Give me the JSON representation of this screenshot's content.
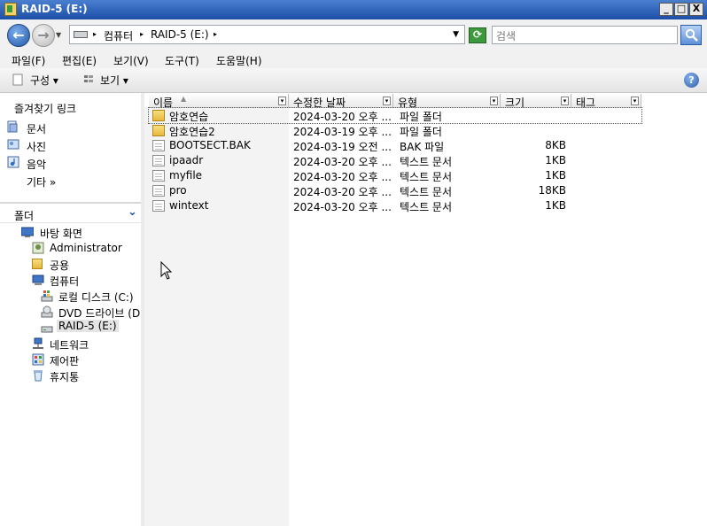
{
  "window": {
    "title": "RAID-5 (E:)",
    "buttons": {
      "minimize": "_",
      "maximize": "□",
      "close": "X"
    }
  },
  "address": {
    "crumbs": [
      "컴퓨터",
      "RAID-5 (E:)"
    ],
    "search_placeholder": "검색"
  },
  "menu": [
    "파일(F)",
    "편집(E)",
    "보기(V)",
    "도구(T)",
    "도움말(H)"
  ],
  "toolbar": {
    "organize": "구성",
    "view": "보기",
    "help": "?"
  },
  "favorites": {
    "title": "즐겨찾기 링크",
    "items": [
      "문서",
      "사진",
      "음악"
    ],
    "more": "기타",
    "more_glyph": "»"
  },
  "folders": {
    "title": "폴더",
    "tree": [
      "바탕 화면",
      "Administrator",
      "공용",
      "컴퓨터",
      "로컬 디스크 (C:)",
      "DVD 드라이브 (D",
      "RAID-5 (E:)",
      "네트워크",
      "제어판",
      "휴지통"
    ]
  },
  "columns": [
    "이름",
    "수정한 날짜",
    "유형",
    "크기",
    "태그"
  ],
  "files": [
    {
      "name": "암호연습",
      "date": "2024-03-20 오후 ...",
      "type": "파일 폴더",
      "size": "",
      "icon": "folder-icon"
    },
    {
      "name": "암호연습2",
      "date": "2024-03-19 오후 ...",
      "type": "파일 폴더",
      "size": "",
      "icon": "folder-icon"
    },
    {
      "name": "BOOTSECT.BAK",
      "date": "2024-03-19 오전 ...",
      "type": "BAK 파일",
      "size": "8KB",
      "icon": "file-icon"
    },
    {
      "name": "ipaadr",
      "date": "2024-03-20 오후 ...",
      "type": "텍스트 문서",
      "size": "1KB",
      "icon": "text-file-icon"
    },
    {
      "name": "myfile",
      "date": "2024-03-20 오후 ...",
      "type": "텍스트 문서",
      "size": "1KB",
      "icon": "text-file-icon"
    },
    {
      "name": "pro",
      "date": "2024-03-20 오후 ...",
      "type": "텍스트 문서",
      "size": "18KB",
      "icon": "text-file-icon"
    },
    {
      "name": "wintext",
      "date": "2024-03-20 오후 ...",
      "type": "텍스트 문서",
      "size": "1KB",
      "icon": "text-file-icon"
    }
  ]
}
